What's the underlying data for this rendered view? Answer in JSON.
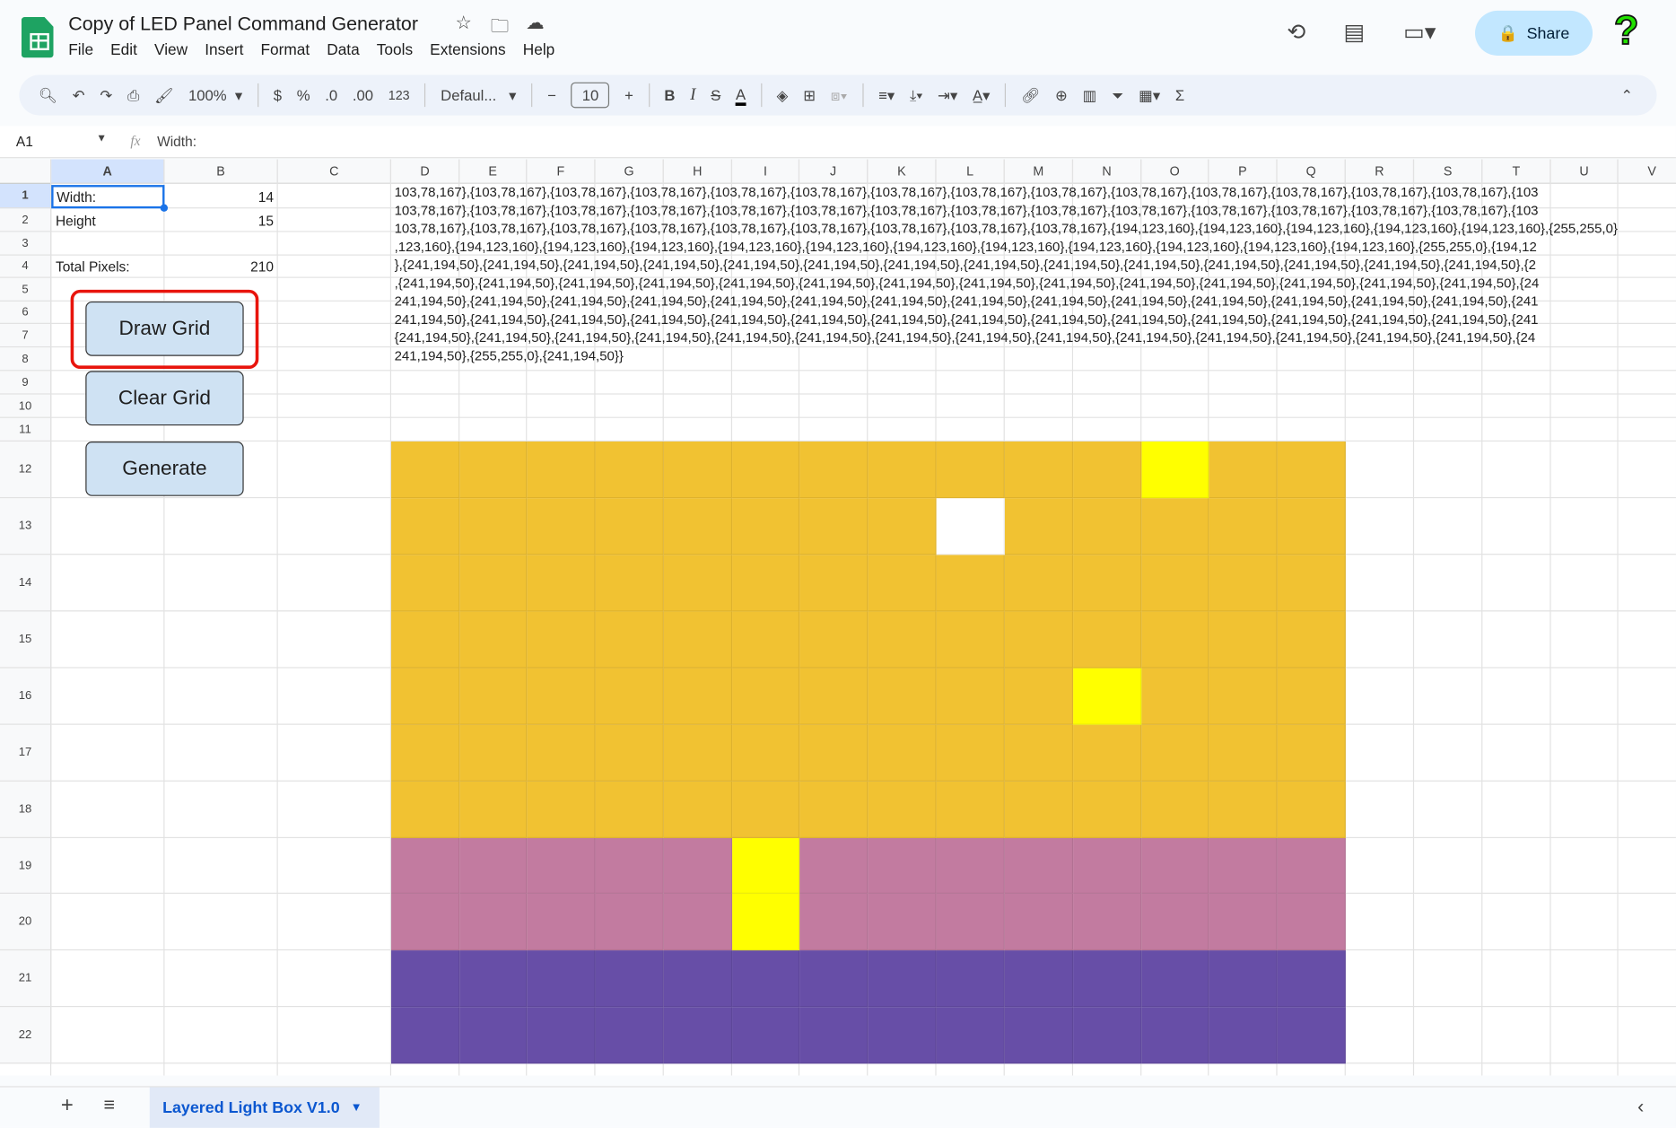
{
  "app": {
    "title": "Copy of LED Panel Command Generator",
    "menu": [
      "File",
      "Edit",
      "View",
      "Insert",
      "Format",
      "Data",
      "Tools",
      "Extensions",
      "Help"
    ],
    "share_label": "Share"
  },
  "toolbar": {
    "zoom": "100%",
    "currency": "$",
    "percent": "%",
    "dec_decrease": ".0",
    "dec_increase": ".00",
    "number_format": "123",
    "font": "Defaul...",
    "font_size": "10",
    "bold": "B",
    "italic": "I"
  },
  "formula_bar": {
    "cell_ref": "A1",
    "fx": "fx",
    "value": "Width:"
  },
  "columns": [
    "A",
    "B",
    "C",
    "D",
    "E",
    "F",
    "G",
    "H",
    "I",
    "J",
    "K",
    "L",
    "M",
    "N",
    "O",
    "P",
    "Q",
    "R",
    "S",
    "T",
    "U",
    "V"
  ],
  "rows": [
    "1",
    "2",
    "3",
    "4",
    "5",
    "6",
    "7",
    "8",
    "9",
    "10",
    "11",
    "12",
    "13",
    "14",
    "15",
    "16",
    "17",
    "18",
    "19",
    "20",
    "21",
    "22"
  ],
  "cells": {
    "a1": "Width:",
    "b1": "14",
    "a2": "Height",
    "b2": "15",
    "a4": "Total Pixels:",
    "b4": "210"
  },
  "buttons": {
    "draw": "Draw Grid",
    "clear": "Clear Grid",
    "generate": "Generate"
  },
  "output_lines": [
    "103,78,167},{103,78,167},{103,78,167},{103,78,167},{103,78,167},{103,78,167},{103,78,167},{103,78,167},{103,78,167},{103,78,167},{103,78,167},{103,78,167},{103,78,167},{103,78,167},{103",
    "103,78,167},{103,78,167},{103,78,167},{103,78,167},{103,78,167},{103,78,167},{103,78,167},{103,78,167},{103,78,167},{103,78,167},{103,78,167},{103,78,167},{103,78,167},{103,78,167},{103",
    "103,78,167},{103,78,167},{103,78,167},{103,78,167},{103,78,167},{103,78,167},{103,78,167},{103,78,167},{103,78,167},{194,123,160},{194,123,160},{194,123,160},{194,123,160},{194,123,160},{255,255,0}",
    ",123,160},{194,123,160},{194,123,160},{194,123,160},{194,123,160},{194,123,160},{194,123,160},{194,123,160},{194,123,160},{194,123,160},{194,123,160},{194,123,160},{255,255,0},{194,12",
    "},{241,194,50},{241,194,50},{241,194,50},{241,194,50},{241,194,50},{241,194,50},{241,194,50},{241,194,50},{241,194,50},{241,194,50},{241,194,50},{241,194,50},{241,194,50},{241,194,50},{2",
    ",{241,194,50},{241,194,50},{241,194,50},{241,194,50},{241,194,50},{241,194,50},{241,194,50},{241,194,50},{241,194,50},{241,194,50},{241,194,50},{241,194,50},{241,194,50},{241,194,50},{24",
    "241,194,50},{241,194,50},{241,194,50},{241,194,50},{241,194,50},{241,194,50},{241,194,50},{241,194,50},{241,194,50},{241,194,50},{241,194,50},{241,194,50},{241,194,50},{241,194,50},{241",
    "241,194,50},{241,194,50},{241,194,50},{241,194,50},{241,194,50},{241,194,50},{241,194,50},{241,194,50},{241,194,50},{241,194,50},{241,194,50},{241,194,50},{241,194,50},{241,194,50},{241",
    "{241,194,50},{241,194,50},{241,194,50},{241,194,50},{241,194,50},{241,194,50},{241,194,50},{241,194,50},{241,194,50},{241,194,50},{241,194,50},{241,194,50},{241,194,50},{241,194,50},{24",
    "241,194,50},{255,255,0},{241,194,50}}"
  ],
  "palette": {
    "o": "#f1c232",
    "y": "#ffff00",
    "w": "#ffffff",
    "p": "#c27ba0",
    "v": "#674ea7"
  },
  "pixel_grid": [
    "oooooooooooyoo",
    "oooooooowooooo",
    "oooooooooooooo",
    "oooooooooooooo",
    "ooooooooooyooo",
    "oooooooooooooo",
    "oooooooooooooo",
    "pppppyppppppppp",
    "pppppyppppppppp",
    "vvvvvvvvvvvvvv",
    "vvvvvvvvvvvvvv"
  ],
  "sheet_tab": {
    "label": "Layered Light Box V1.0"
  },
  "colors": {
    "accent": "#0b57d0",
    "share_bg": "#c2e7ff",
    "highlight_box": "#e8140c"
  }
}
